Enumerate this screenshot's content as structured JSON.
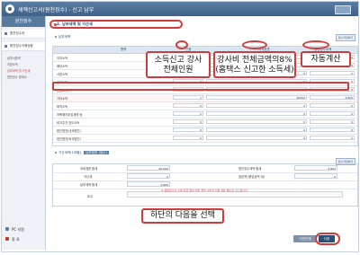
{
  "window": {
    "title": "세액신고서(원천징수) - 신고 납부"
  },
  "sidebar": {
    "header": "원천징수",
    "items": [
      {
        "label": "원천징수세"
      },
      {
        "label": "원천징수이행상황"
      }
    ],
    "subitems": [
      {
        "label": "납부서출력",
        "active": false
      },
      {
        "label": "지방소득",
        "active": false
      },
      {
        "label": "납부세액 및 가산세",
        "active": true
      },
      {
        "label": "원천징수 명세서",
        "active": false
      }
    ],
    "bottom": [
      {
        "label": "PC 지원"
      },
      {
        "label": "종 료"
      }
    ]
  },
  "section": {
    "title": "2. 납부세액 및 가산세"
  },
  "table": {
    "subtitle": "납부세액",
    "save_label": "임시저장하기",
    "headers": [
      "항목",
      "인원",
      "과세표준",
      "원천징수세액"
    ],
    "rows": [
      {
        "label": "이자소득",
        "a": "0",
        "b": "0",
        "c": "0"
      },
      {
        "label": "배당소득",
        "a": "0",
        "b": "0",
        "c": "0"
      },
      {
        "label": "사업소득",
        "a": "0",
        "b": "0",
        "c": "0"
      },
      {
        "label": "근로소득",
        "a": "0",
        "b": "0",
        "c": "0"
      },
      {
        "label": "연금소득",
        "a": "0",
        "b": "0",
        "c": "0"
      },
      {
        "label": "기타소득",
        "a": "1",
        "b": "60000",
        "c": "4,800"
      },
      {
        "label": "퇴직소득",
        "a": "0",
        "b": "0",
        "c": "0"
      },
      {
        "label": "저축해지추징세액 등",
        "a": "0",
        "b": "0",
        "c": "0"
      },
      {
        "label": "비거주자 양도소득",
        "a": "0",
        "b": "0",
        "c": "0"
      },
      {
        "label": "법인원천(내국법인)",
        "a": "0",
        "b": "0",
        "c": "0"
      },
      {
        "label": "법인원천(외국법인)",
        "a": "0",
        "b": "0",
        "c": "0"
      }
    ]
  },
  "callouts": {
    "a": "소득신고 강사\n전체인원",
    "b": "강사비 전체금액의8%\n(홈택스 신고한 소득세)",
    "c": "자동계산",
    "d": "하단의 다음을 선택"
  },
  "summary": {
    "subtitle": "가산세액(1개월)",
    "tag": "납부일정 (일수)",
    "save_label": "임시저장하기",
    "rows": [
      {
        "k1": "과세표준 합계",
        "v1": "60,000",
        "k2": "원천징수세액 합계",
        "v2": "4,800"
      },
      {
        "k1": "가산세",
        "v1": "0",
        "k2": "환급액 (충당금액 계)",
        "v2": "0"
      },
      {
        "k1": "납부세액 합계",
        "v1": "4,800",
        "k2": "",
        "v2": ""
      },
      {
        "k1": "비고",
        "v1": "",
        "k2": "",
        "v2": ""
      }
    ],
    "note": "※ 원천징수할 소득 지급 월이 다른 경우 나머지 다른 월은 별도로 신고합니다"
  },
  "buttons": {
    "prev": "이전단계",
    "next": "다음"
  },
  "colors": {
    "accent": "#d23b3b",
    "title_bar": "#3e6189",
    "header_bg": "#dbe6f1"
  }
}
